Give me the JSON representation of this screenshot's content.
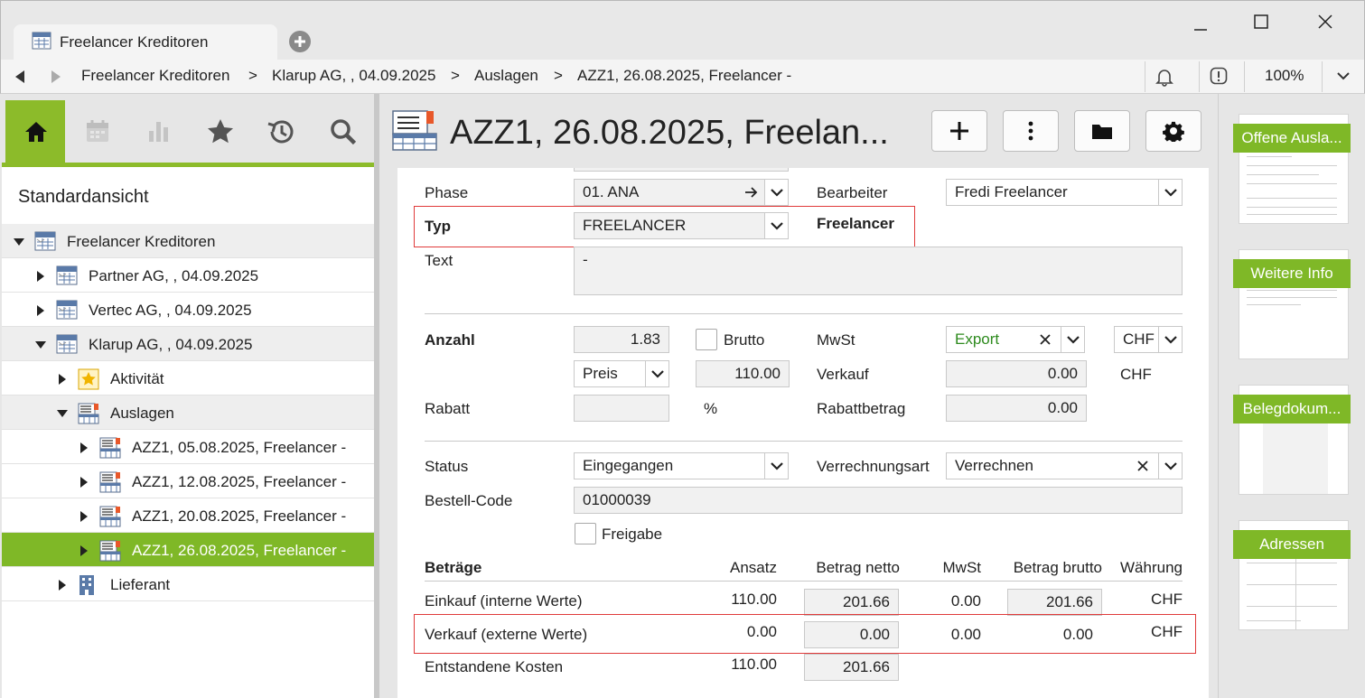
{
  "window": {
    "tab_title": "Freelancer Kreditoren",
    "tab_icon": "expense-list-icon"
  },
  "navbar": {
    "breadcrumbs": [
      "Freelancer Kreditoren",
      "Klarup AG, , 04.09.2025",
      "Auslagen",
      "AZZ1, 26.08.2025, Freelancer -"
    ],
    "separator": ">",
    "zoom": "100%"
  },
  "left": {
    "view_title": "Standardansicht",
    "tree": [
      {
        "label": "Freelancer Kreditoren",
        "level": 0,
        "expanded": true,
        "icon": "expense-list-icon"
      },
      {
        "label": "Partner AG, , 04.09.2025",
        "level": 1,
        "expanded": false,
        "icon": "expense-list-icon"
      },
      {
        "label": "Vertec AG, , 04.09.2025",
        "level": 1,
        "expanded": false,
        "icon": "expense-list-icon"
      },
      {
        "label": "Klarup AG, , 04.09.2025",
        "level": 1,
        "expanded": true,
        "icon": "expense-list-icon"
      },
      {
        "label": "Aktivität",
        "level": 2,
        "expanded": false,
        "icon": "activity-star-icon"
      },
      {
        "label": "Auslagen",
        "level": 2,
        "expanded": true,
        "icon": "expense-icon"
      },
      {
        "label": "AZZ1, 05.08.2025, Freelancer -",
        "level": 3,
        "expanded": false,
        "icon": "expense-icon"
      },
      {
        "label": "AZZ1, 12.08.2025, Freelancer -",
        "level": 3,
        "expanded": false,
        "icon": "expense-icon"
      },
      {
        "label": "AZZ1, 20.08.2025, Freelancer -",
        "level": 3,
        "expanded": false,
        "icon": "expense-icon"
      },
      {
        "label": "AZZ1, 26.08.2025, Freelancer -",
        "level": 3,
        "expanded": false,
        "icon": "expense-icon",
        "selected": true
      },
      {
        "label": "Lieferant",
        "level": 2,
        "expanded": false,
        "icon": "building-icon"
      }
    ]
  },
  "main": {
    "title": "AZZ1, 26.08.2025, Freelan...",
    "form": {
      "phase_label": "Phase",
      "phase_value": "01. ANA",
      "bearbeiter_label": "Bearbeiter",
      "bearbeiter_value": "Fredi Freelancer",
      "typ_label": "Typ",
      "typ_value": "FREELANCER",
      "typ_description": "Freelancer",
      "text_label": "Text",
      "text_value": "-",
      "anzahl_label": "Anzahl",
      "anzahl_value": "1.83",
      "brutto_label": "Brutto",
      "mwst_label": "MwSt",
      "mwst_value": "Export",
      "currency_value": "CHF",
      "preis_value": "Preis",
      "preis_amount": "110.00",
      "verkauf_label": "Verkauf",
      "verkauf_value": "0.00",
      "verkauf_currency": "CHF",
      "rabatt_label": "Rabatt",
      "rabatt_value": "",
      "percent": "%",
      "rabattbetrag_label": "Rabattbetrag",
      "rabattbetrag_value": "0.00",
      "status_label": "Status",
      "status_value": "Eingegangen",
      "verrechnungsart_label": "Verrechnungsart",
      "verrechnungsart_value": "Verrechnen",
      "bestellcode_label": "Bestell-Code",
      "bestellcode_value": "01000039",
      "freigabe_label": "Freigabe"
    },
    "amounts": {
      "title": "Beträge",
      "headers": [
        "Ansatz",
        "Betrag netto",
        "MwSt",
        "Betrag brutto",
        "Währung"
      ],
      "rows": [
        {
          "label": "Einkauf (interne Werte)",
          "ansatz": "110.00",
          "netto": "201.66",
          "mwst": "0.00",
          "brutto": "201.66",
          "waehrung": "CHF"
        },
        {
          "label": "Verkauf (externe Werte)",
          "ansatz": "0.00",
          "netto": "0.00",
          "mwst": "0.00",
          "brutto": "0.00",
          "waehrung": "CHF"
        },
        {
          "label": "Entstandene Kosten",
          "ansatz": "110.00",
          "netto": "201.66"
        }
      ]
    }
  },
  "right": {
    "cards": [
      "Offene Ausla...",
      "Weitere Info",
      "Belegdokum...",
      "Adressen"
    ]
  },
  "colors": {
    "accent": "#7fb827",
    "highlight_box": "#e03a3a",
    "mwst_text": "#2e8b1e"
  }
}
